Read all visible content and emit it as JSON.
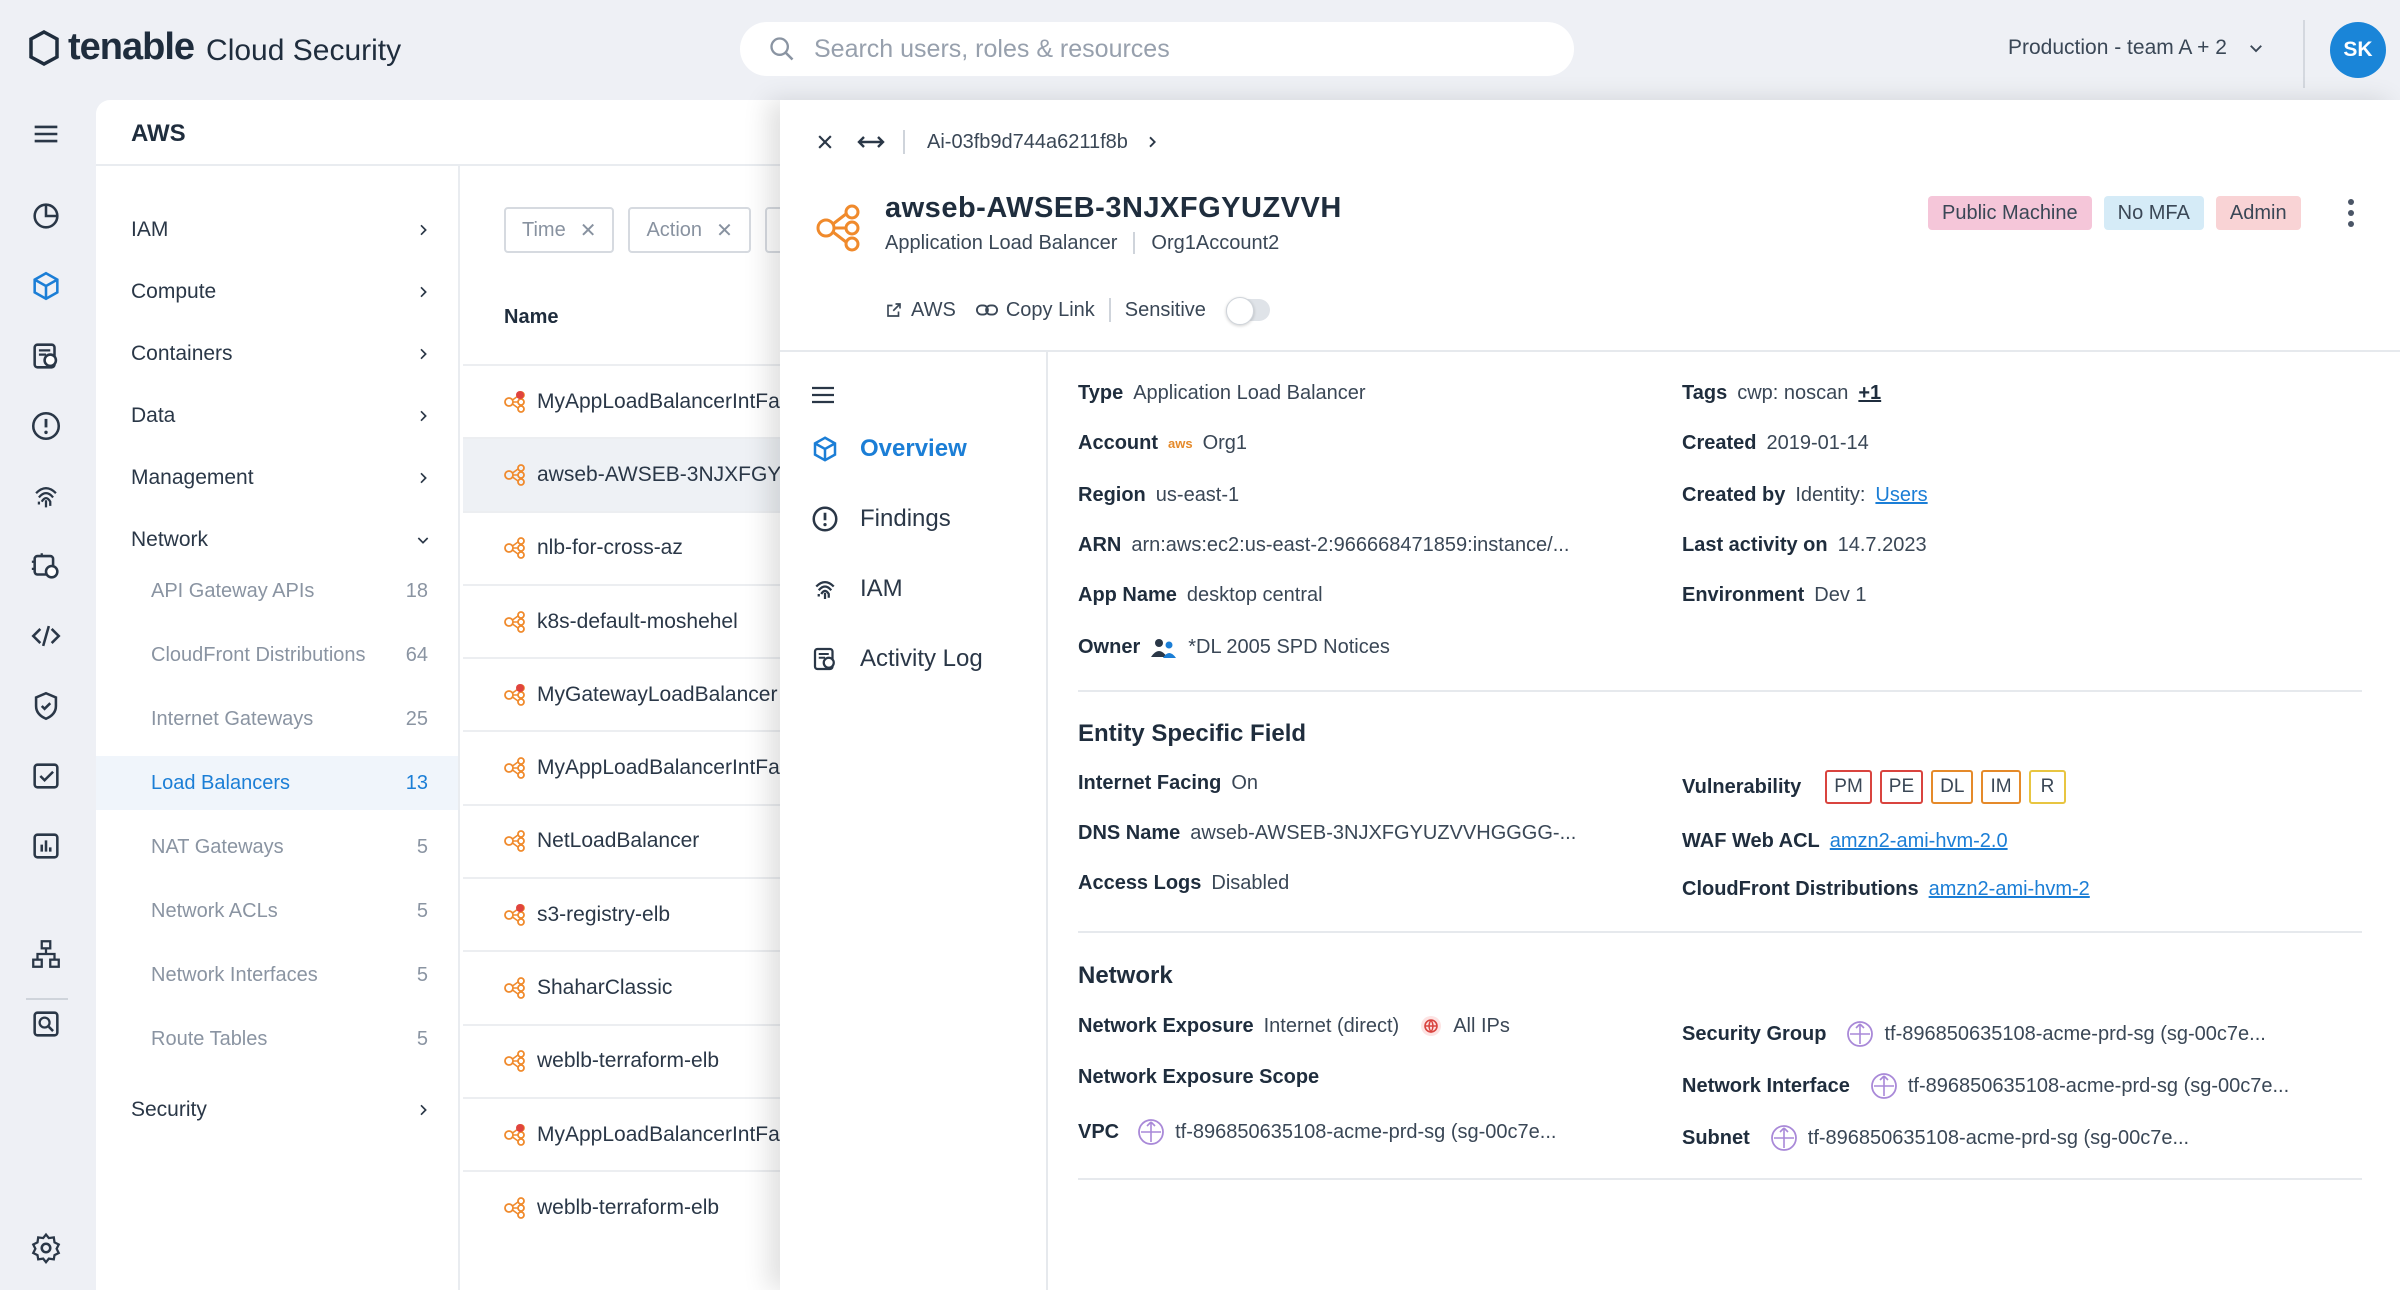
{
  "header": {
    "brand": "tenable",
    "product": "Cloud Security",
    "search_placeholder": "Search users, roles & resources",
    "scope": "Production - team A + 2",
    "avatar": "SK"
  },
  "rail": {
    "icons": [
      "menu-icon",
      "dashboard-icon",
      "inventory-icon",
      "reports-icon",
      "findings-icon",
      "fingerprint-icon",
      "workloads-icon",
      "code-icon",
      "shield-icon",
      "checklist-icon",
      "analytics-icon",
      "org-chart-icon",
      "search-doc-icon",
      "settings-icon"
    ]
  },
  "panel": {
    "title": "AWS"
  },
  "nav": {
    "categories": [
      {
        "label": "IAM"
      },
      {
        "label": "Compute"
      },
      {
        "label": "Containers"
      },
      {
        "label": "Data"
      },
      {
        "label": "Management"
      },
      {
        "label": "Network"
      },
      {
        "label": "Security"
      }
    ],
    "network_items": [
      {
        "label": "API Gateway APIs",
        "count": "18"
      },
      {
        "label": "CloudFront Distributions",
        "count": "64"
      },
      {
        "label": "Internet Gateways",
        "count": "25"
      },
      {
        "label": "Load Balancers",
        "count": "13"
      },
      {
        "label": "NAT Gateways",
        "count": "5"
      },
      {
        "label": "Network ACLs",
        "count": "5"
      },
      {
        "label": "Network Interfaces",
        "count": "5"
      },
      {
        "label": "Route Tables",
        "count": "5"
      }
    ]
  },
  "list": {
    "filters": [
      "Time",
      "Action"
    ],
    "column": "Name",
    "rows": [
      {
        "name": "MyAppLoadBalancerIntFa",
        "alert": true
      },
      {
        "name": "awseb-AWSEB-3NJXFGY",
        "alert": false
      },
      {
        "name": "nlb-for-cross-az",
        "alert": false
      },
      {
        "name": "k8s-default-moshehel",
        "alert": false
      },
      {
        "name": "MyGatewayLoadBalancer",
        "alert": true
      },
      {
        "name": "MyAppLoadBalancerIntFa",
        "alert": false
      },
      {
        "name": "NetLoadBalancer",
        "alert": false
      },
      {
        "name": "s3-registry-elb",
        "alert": true
      },
      {
        "name": "ShaharClassic",
        "alert": false
      },
      {
        "name": "weblb-terraform-elb",
        "alert": false
      },
      {
        "name": "MyAppLoadBalancerIntFa",
        "alert": true
      },
      {
        "name": "weblb-terraform-elb",
        "alert": false
      }
    ]
  },
  "drawer": {
    "crumb": "Ai-03fb9d744a6211f8b",
    "name": "awseb-AWSEB-3NJXFGYUZVVH",
    "subtitle_type": "Application Load Balancer",
    "subtitle_account": "Org1Account2",
    "badges": [
      {
        "label": "Public Machine",
        "bg": "#f5c6d9"
      },
      {
        "label": "No MFA",
        "bg": "#d5ebf7"
      },
      {
        "label": "Admin",
        "bg": "#f9d3d5"
      }
    ],
    "actions": {
      "aws": "AWS",
      "copy": "Copy Link",
      "sensitive": "Sensitive"
    },
    "menu": [
      "Overview",
      "Findings",
      "IAM",
      "Activity Log"
    ]
  },
  "overview": {
    "type_label": "Type",
    "type_value": "Application Load Balancer",
    "account_label": "Account",
    "account_aws": "aws",
    "account_value": "Org1",
    "region_label": "Region",
    "region_value": "us-east-1",
    "arn_label": "ARN",
    "arn_value": "arn:aws:ec2:us-east-2:966668471859:instance/...",
    "app_label": "App Name",
    "app_value": "desktop central",
    "owner_label": "Owner",
    "owner_value": "*DL 2005 SPD Notices",
    "tags_label": "Tags",
    "tags_value": "cwp: noscan",
    "tags_more": "+1",
    "created_label": "Created",
    "created_value": "2019-01-14",
    "createdby_label": "Created by",
    "createdby_value": "Identity:",
    "createdby_link": "Users",
    "lastact_label": "Last activity on",
    "lastact_value": "14.7.2023",
    "env_label": "Environment",
    "env_value": "Dev 1"
  },
  "entity": {
    "title": "Entity Specific Field",
    "facing_label": "Internet Facing",
    "facing_value": "On",
    "dns_label": "DNS Name",
    "dns_value": "awseb-AWSEB-3NJXFGYUZVVHGGGG-...",
    "logs_label": "Access Logs",
    "logs_value": "Disabled",
    "vuln_label": "Vulnerability",
    "vulns": [
      {
        "label": "PM",
        "color": "#d9443f"
      },
      {
        "label": "PE",
        "color": "#d9443f"
      },
      {
        "label": "DL",
        "color": "#e58a2a"
      },
      {
        "label": "IM",
        "color": "#e58a2a"
      },
      {
        "label": "R",
        "color": "#e8c541"
      }
    ],
    "waf_label": "WAF Web ACL",
    "waf_value": "amzn2-ami-hvm-2.0",
    "cf_label": "CloudFront Distributions",
    "cf_value": "amzn2-ami-hvm-2"
  },
  "network": {
    "title": "Network",
    "exposure_label": "Network Exposure",
    "exposure_value": "Internet (direct)",
    "exposure_ips": "All IPs",
    "scope_label": "Network Exposure Scope",
    "vpc_label": "VPC",
    "vpc_value": "tf-896850635108-acme-prd-sg (sg-00c7e...",
    "sg_label": "Security Group",
    "sg_value": "tf-896850635108-acme-prd-sg (sg-00c7e...",
    "ni_label": "Network Interface",
    "ni_value": "tf-896850635108-acme-prd-sg (sg-00c7e...",
    "subnet_label": "Subnet",
    "subnet_value": "tf-896850635108-acme-prd-sg (sg-00c7e..."
  },
  "colors": {
    "accent": "#1b7ed6",
    "lb_icon": "#f08a2c"
  }
}
